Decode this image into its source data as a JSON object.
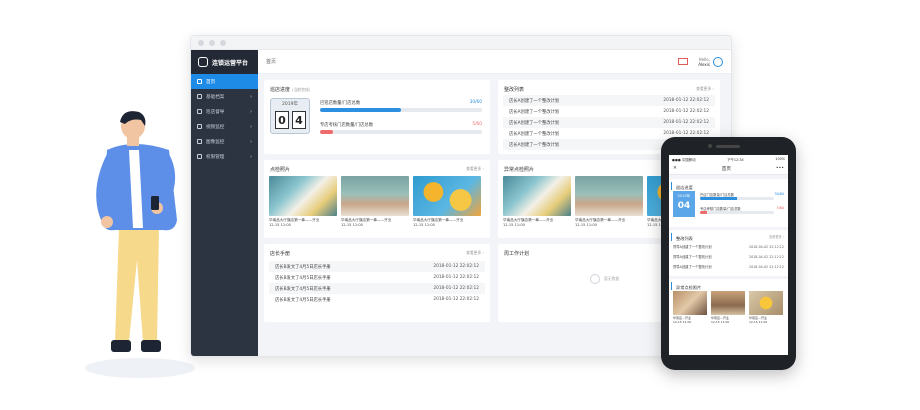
{
  "app": {
    "brand": "连锁运营平台",
    "breadcrumb": "首页"
  },
  "sidebar": {
    "items": [
      {
        "label": "首页",
        "active": true,
        "arrow": ""
      },
      {
        "label": "基础档案",
        "active": false,
        "arrow": "›"
      },
      {
        "label": "巡店督导",
        "active": false,
        "arrow": "›"
      },
      {
        "label": "视频监控",
        "active": false,
        "arrow": "›"
      },
      {
        "label": "图像监控",
        "active": false,
        "arrow": "›"
      },
      {
        "label": "权限管理",
        "active": false,
        "arrow": "›"
      }
    ]
  },
  "user": {
    "greeting": "Hello,",
    "name": "Alexis"
  },
  "inspection": {
    "title": "巡店进度",
    "subtitle": "(当前完成)",
    "year": "2019年",
    "day": [
      "0",
      "4"
    ],
    "items": [
      {
        "label": "巴巡店数量/门店总数",
        "value": "30/60",
        "percent": 50,
        "color": "#2d8fe0"
      },
      {
        "label": "专店考核门店数量/门店总数",
        "value": "5/60",
        "percent": 8,
        "color": "#ef6b6b"
      }
    ]
  },
  "rectify": {
    "title": "整改列表",
    "more": "查看更多 ›",
    "rows": [
      {
        "text": "店长A创建了一个整改计划",
        "time": "2018-01-12 22:02:12"
      },
      {
        "text": "店长A创建了一个整改计划",
        "time": "2018-01-12 22:02:12"
      },
      {
        "text": "店长A创建了一个整改计划",
        "time": "2018-01-12 22:02:12"
      },
      {
        "text": "店长A创建了一个整改计划",
        "time": "2018-01-12 22:02:12"
      },
      {
        "text": "店长A创建了一个整改计划",
        "time": ""
      }
    ]
  },
  "spot_photos": {
    "title": "点检照片",
    "more": "查看更多 ›",
    "photos": [
      {
        "caption": "华南品大厅旗店第一拳——开业",
        "date": "12-15 11:00"
      },
      {
        "caption": "华南品大厅旗店第一拳——开业",
        "date": "12-15 11:00"
      },
      {
        "caption": "华南品大厅旗店第一拳——开业",
        "date": "12-15 11:00"
      }
    ]
  },
  "abnormal_photos": {
    "title": "异常点检照片",
    "more": "查看更多 ›",
    "photos": [
      {
        "caption": "华南品大厅旗店第一拳——开业",
        "date": "12-15 11:00"
      },
      {
        "caption": "华南品大厅旗店第一拳——开业",
        "date": "12-15 11:00"
      },
      {
        "caption": "华南品大厅旗店第一拳——开业",
        "date": "12-15 11:00"
      }
    ]
  },
  "manual": {
    "title": "店长手册",
    "more": "查看更多 ›",
    "rows": [
      {
        "text": "店长B发文了4月5日店长手册",
        "time": "2018-01-12 22:02:12"
      },
      {
        "text": "店长B发文了4月5日店长手册",
        "time": "2018-01-12 22:02:12"
      },
      {
        "text": "店长B发文了4月5日店长手册",
        "time": "2018-01-12 22:02:12"
      },
      {
        "text": "店长B发文了4月5日店长手册",
        "time": "2018-01-12 22:02:12"
      }
    ]
  },
  "weekly_plan": {
    "title": "周工作计划",
    "empty": "暂无数据"
  },
  "phone": {
    "carrier": "●●● 中国移动",
    "clock": "下午12:34",
    "battery": "100%",
    "nav_title": "首页",
    "close": "✕",
    "menu": "•••",
    "inspection_title": "巡店进度",
    "year": "2019年",
    "day": "04",
    "items": [
      {
        "label": "巴店门店数量/门店总数",
        "value": "30/60",
        "percent": 50,
        "color": "#2d8fe0"
      },
      {
        "label": "专店考核门店数量/门店总数",
        "value": "5/60",
        "percent": 10,
        "color": "#ef6b6b"
      }
    ],
    "rectify_title": "整改列表",
    "more": "查看更多 ›",
    "rows": [
      {
        "text": "督导A创建了一个整改计划",
        "time": "2018-04-02 22:12:12"
      },
      {
        "text": "督导A创建了一个整改计划",
        "time": "2018-04-02 22:12:12"
      },
      {
        "text": "督导A创建了一个整改计划",
        "time": "2018-04-02 22:12:12"
      }
    ],
    "photos_title": "异常点检照片",
    "photos": [
      {
        "caption": "华南店—开业",
        "date": "12-15 11:00"
      },
      {
        "caption": "华南店—开业",
        "date": "12-15 11:00"
      },
      {
        "caption": "华南店—开业",
        "date": "12-15 11:00"
      }
    ]
  }
}
